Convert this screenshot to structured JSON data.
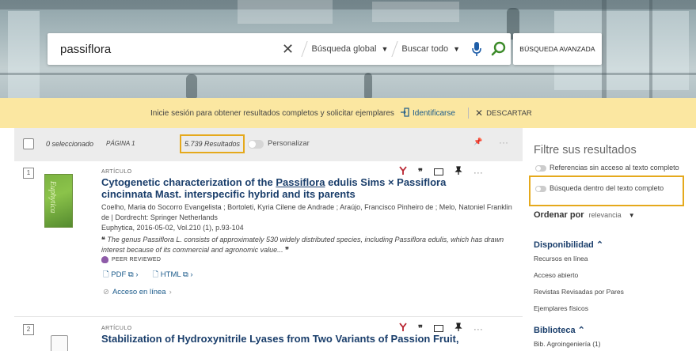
{
  "search": {
    "query": "passiflora",
    "scope_label": "Búsqueda global",
    "filter_label": "Buscar todo",
    "advanced_label": "BÚSQUEDA AVANZADA"
  },
  "signin_banner": {
    "message": "Inicie sesión para obtener resultados completos y solicitar ejemplares",
    "login_label": "Identificarse",
    "dismiss_label": "DESCARTAR"
  },
  "toolbar": {
    "selected": "0 seleccionado",
    "page": "PÁGINA 1",
    "results_count": "5.739 Resultados",
    "personalize": "Personalizar"
  },
  "results": [
    {
      "num": "1",
      "type": "ARTÍCULO",
      "title_pre": "Cytogenetic characterization of the ",
      "title_hl": "Passiflora",
      "title_post": " edulis Sims × Passiflora cincinnata Mast. interspecific hybrid and its parents",
      "authors": "Coelho, Maria do Socorro Evangelista ; Bortoleti, Kyria Cilene de Andrade ; Araújo, Francisco Pinheiro de ; Melo, Natoniel Franklin de | Dordrecht: Springer Netherlands",
      "source": "Euphytica, 2016-05-02, Vol.210 (1), p.93-104",
      "snippet": "The genus Passiflora L. consists of approximately 530 widely distributed species, including Passiflora edulis, which has drawn interest because of its commercial and agronomic value...",
      "peer": "PEER REVIEWED",
      "pdf": "PDF",
      "html": "HTML",
      "online": "Acceso en línea",
      "thumb_text": "Euphytica"
    },
    {
      "num": "2",
      "type": "ARTÍCULO",
      "title": "Stabilization of Hydroxynitrile Lyases from Two Variants of Passion Fruit,"
    }
  ],
  "sidebar": {
    "heading": "Filtre sus resultados",
    "toggle1": "Referencias sin acceso al texto completo",
    "toggle2": "Búsqueda dentro del texto completo",
    "sort_label": "Ordenar por",
    "sort_value": "relevancia",
    "availability_heading": "Disponibilidad",
    "availability_items": [
      "Recursos en línea",
      "Acceso abierto",
      "Revistas Revisadas por Pares",
      "Ejemplares físicos"
    ],
    "library_heading": "Biblioteca",
    "library_items": [
      "Bib. Agroingeniería (1)"
    ]
  },
  "colors": {
    "accent": "#e5a91c",
    "link": "#1a5a8a",
    "title": "#1a3e6b",
    "search_go": "#3d8b2a",
    "mic": "#1f5ea8",
    "pin": "#b8232f",
    "banner": "#fbe7a1"
  }
}
